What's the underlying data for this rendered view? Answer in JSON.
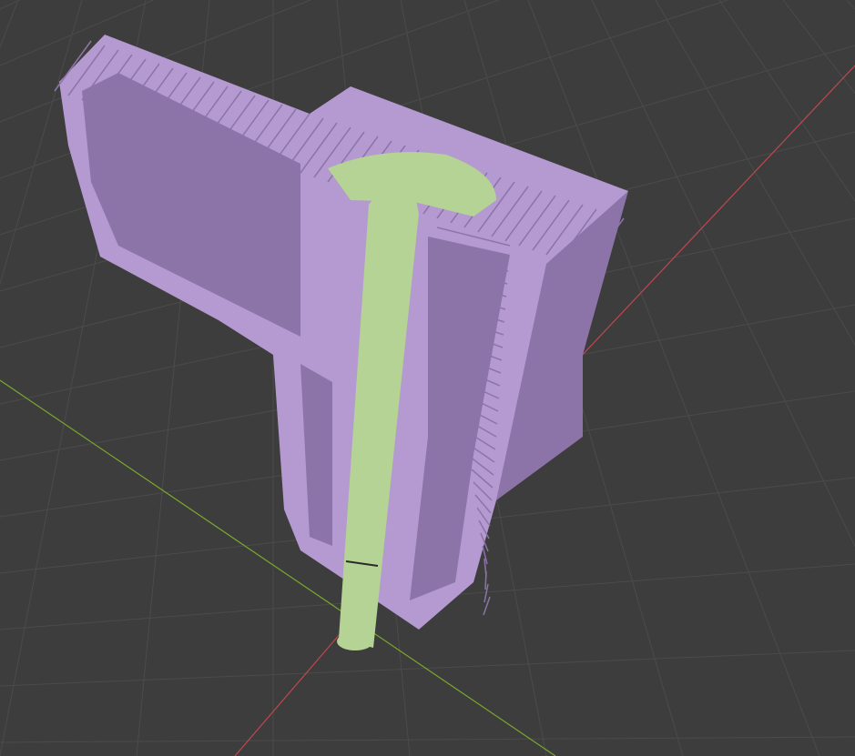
{
  "viewport": {
    "background": "#3d3d3d",
    "grid_color": "#4b4b4b",
    "x_axis_color": "#c0474f",
    "y_axis_color": "#7aa82c",
    "object_color": "#b49ad0",
    "object_shadow": "#8d74a8",
    "rod_color": "#b5d394",
    "rod_shadow": "#93b374"
  }
}
